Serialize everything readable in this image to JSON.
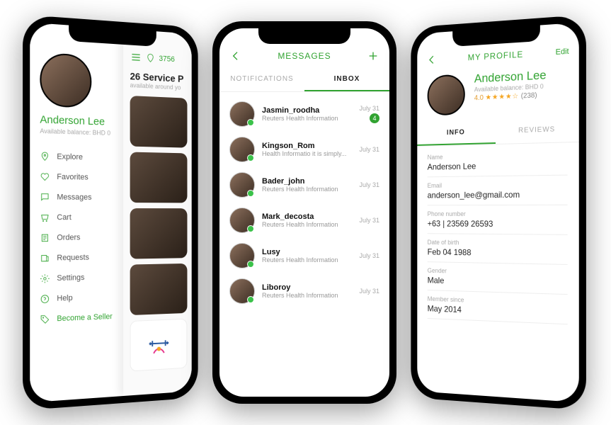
{
  "phone1": {
    "user_name": "Anderson Lee",
    "balance": "Available balance: BHD 0",
    "menu": {
      "explore": "Explore",
      "favorites": "Favorites",
      "messages": "Messages",
      "cart": "Cart",
      "orders": "Orders",
      "requests": "Requests",
      "settings": "Settings",
      "help": "Help",
      "seller": "Become a Seller"
    },
    "main": {
      "location": "3756",
      "heading": "26 Service P",
      "sub": "available around yo"
    }
  },
  "phone2": {
    "title": "MESSAGES",
    "tabs": {
      "notifications": "NOTIFICATIONS",
      "inbox": "INBOX"
    },
    "items": [
      {
        "name": "Jasmin_roodha",
        "text": "Reuters Health Information",
        "date": "July 31",
        "badge": "4"
      },
      {
        "name": "Kingson_Rom",
        "text": "Health Informatio it is simply...",
        "date": "July 31",
        "badge": ""
      },
      {
        "name": "Bader_john",
        "text": "Reuters Health Information",
        "date": "July 31",
        "badge": ""
      },
      {
        "name": "Mark_decosta",
        "text": "Reuters Health Information",
        "date": "July 31",
        "badge": ""
      },
      {
        "name": "Lusy",
        "text": "Reuters Health Information",
        "date": "July 31",
        "badge": ""
      },
      {
        "name": "Liboroy",
        "text": "Reuters Health Information",
        "date": "July 31",
        "badge": ""
      }
    ]
  },
  "phone3": {
    "title": "MY PROFILE",
    "edit": "Edit",
    "name": "Anderson Lee",
    "balance": "Available balance: BHD 0",
    "rating_score": "4.0",
    "rating_stars": "★★★★☆",
    "rating_count": "(238)",
    "tabs": {
      "info": "INFO",
      "reviews": "REVIEWS"
    },
    "fields": [
      {
        "label": "Name",
        "value": "Anderson Lee"
      },
      {
        "label": "Email",
        "value": "anderson_lee@gmail.com"
      },
      {
        "label": "Phone number",
        "value": "+63 | 23569 26593"
      },
      {
        "label": "Date of birth",
        "value": "Feb 04 1988"
      },
      {
        "label": "Gender",
        "value": "Male"
      },
      {
        "label": "Member since",
        "value": "May 2014"
      }
    ]
  }
}
